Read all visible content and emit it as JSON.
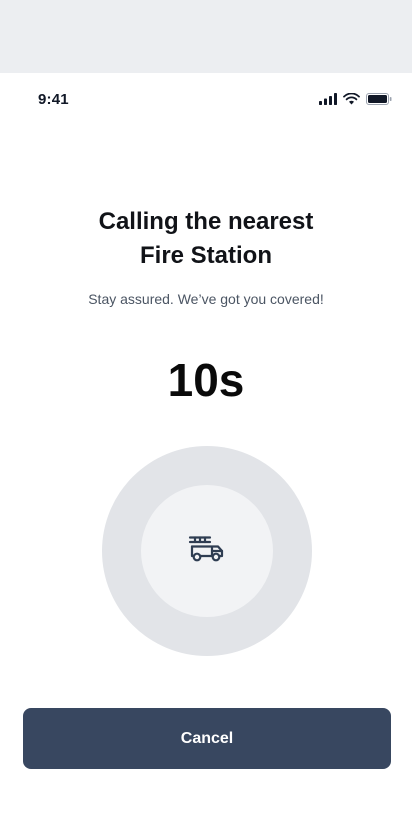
{
  "status_bar": {
    "time": "9:41",
    "icons": [
      "signal-icon",
      "wifi-icon",
      "battery-icon"
    ]
  },
  "call": {
    "title_line1": "Calling the nearest",
    "title_line2": "Fire Station",
    "subtitle": "Stay assured. We’ve got you covered!",
    "countdown": "10s",
    "center_icon": "fire-truck-icon"
  },
  "actions": {
    "cancel_label": "Cancel"
  },
  "colors": {
    "button": "#384760",
    "ring_outer": "#e2e4e8",
    "ring_inner": "#f2f3f5",
    "background_band": "#eceef1"
  }
}
